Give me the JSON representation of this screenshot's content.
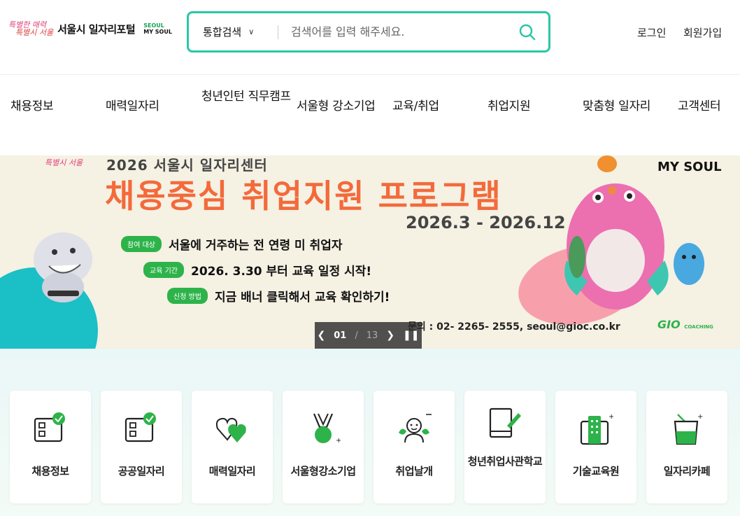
{
  "header": {
    "logo_script_line1": "특별한 매력",
    "logo_script_line2": "특별시 서울",
    "logo_title": "서울시 일자리포털",
    "logo_badge_line1": "SEOUL",
    "logo_badge_line2": "MY SOUL"
  },
  "search": {
    "category": "통합검색",
    "placeholder": "검색어를 입력 해주세요."
  },
  "util": {
    "login": "로그인",
    "signup": "회원가입"
  },
  "nav": {
    "items": [
      "채용정보",
      "매력일자리",
      "청년인턴 직무캠프",
      "서울형 강소기업",
      "교육/취업",
      "취업지원",
      "맞춤형 일자리",
      "고객센터"
    ]
  },
  "banner": {
    "brand": "특별시 서울",
    "subtitle": "2026 서울시 일자리센터",
    "title": "채용중심 취업지원 프로그램",
    "period": "2026.3 - 2026.12",
    "rows": [
      {
        "tag": "참여 대상",
        "text": "서울에 거주하는 전 연령 미 취업자"
      },
      {
        "tag": "교육 기간",
        "text": "2026. 3.30 부터 교육 일정 시작!"
      },
      {
        "tag": "신청 방법",
        "text": "지금 배너 클릭해서 교육 확인하기!"
      }
    ],
    "contact": "문의 : 02- 2265- 2555,  seoul@gioc.co.kr",
    "partner": "GIO",
    "partner_sub": "COACHING",
    "myseoul": "MY SOUL",
    "pager": {
      "current": "01",
      "separator": "/",
      "total": "13"
    }
  },
  "quick_menu": [
    {
      "label": "채용정보",
      "icon": "job-board-check-icon"
    },
    {
      "label": "공공일자리",
      "icon": "public-job-check-icon"
    },
    {
      "label": "매력일자리",
      "icon": "hearts-icon"
    },
    {
      "label": "서울형강소기업",
      "icon": "medal-icon"
    },
    {
      "label": "취업날개",
      "icon": "person-wings-icon"
    },
    {
      "label": "청년취업사관학교",
      "icon": "book-pen-icon"
    },
    {
      "label": "기술교육원",
      "icon": "building-icon"
    },
    {
      "label": "일자리카페",
      "icon": "cup-icon"
    }
  ],
  "colors": {
    "accent": "#2cc6a8",
    "green": "#2db34a",
    "banner_title": "#f36a3b"
  }
}
